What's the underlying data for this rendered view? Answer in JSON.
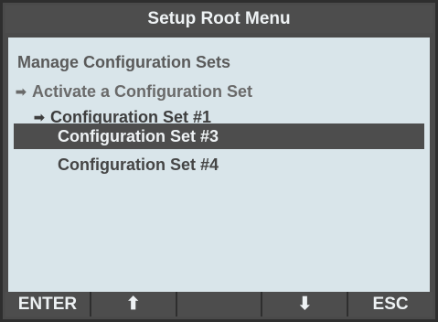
{
  "header": {
    "title": "Setup Root Menu"
  },
  "menu": {
    "items": [
      {
        "label": "Manage Configuration Sets",
        "prefix": ""
      },
      {
        "label": "Activate a Configuration Set",
        "prefix": "➡"
      },
      {
        "label": "Configuration Set #1",
        "prefix": "➡"
      },
      {
        "label": "Configuration Set #3",
        "prefix": "",
        "selected": true
      },
      {
        "label": "Configuration Set #4",
        "prefix": ""
      }
    ]
  },
  "softkeys": [
    {
      "label": "ENTER",
      "icon": ""
    },
    {
      "label": "",
      "icon": "up-arrow-icon",
      "glyph": "⬆"
    },
    {
      "label": "",
      "icon": ""
    },
    {
      "label": "",
      "icon": "down-arrow-icon",
      "glyph": "⬇"
    },
    {
      "label": "ESC",
      "icon": ""
    }
  ],
  "colors": {
    "bezel": "#4d4d4d",
    "screen": "#d9e5ea",
    "text": "#545454",
    "highlight_text": "#eef2f4"
  }
}
